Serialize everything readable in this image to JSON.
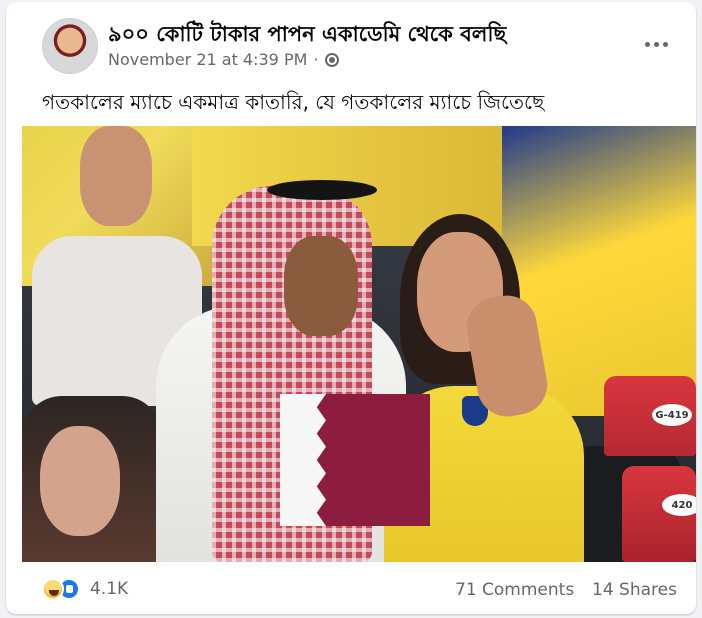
{
  "post": {
    "page_name": "৯০০ কোটি টাকার পাপন একাডেমি থেকে বলছি",
    "timestamp": "November 21 at 4:39 PM",
    "separator": "·",
    "caption": "গতকালের ম্যাচে একমাত্র কাতারি, যে গতকালের ম্যাচে জিতেছে",
    "privacy_icon": "globe-icon",
    "more_icon": "more-options-icon"
  },
  "photo": {
    "seat_labels": [
      "G-419",
      "420"
    ]
  },
  "footer": {
    "reaction_icons": [
      "haha-icon",
      "like-icon"
    ],
    "reaction_count": "4.1K",
    "comments": "71 Comments",
    "shares": "14 Shares"
  },
  "colors": {
    "secondary_text": "#65676b",
    "like_blue": "#1877f2",
    "card_bg": "#ffffff",
    "page_bg": "#f0f2f5"
  }
}
